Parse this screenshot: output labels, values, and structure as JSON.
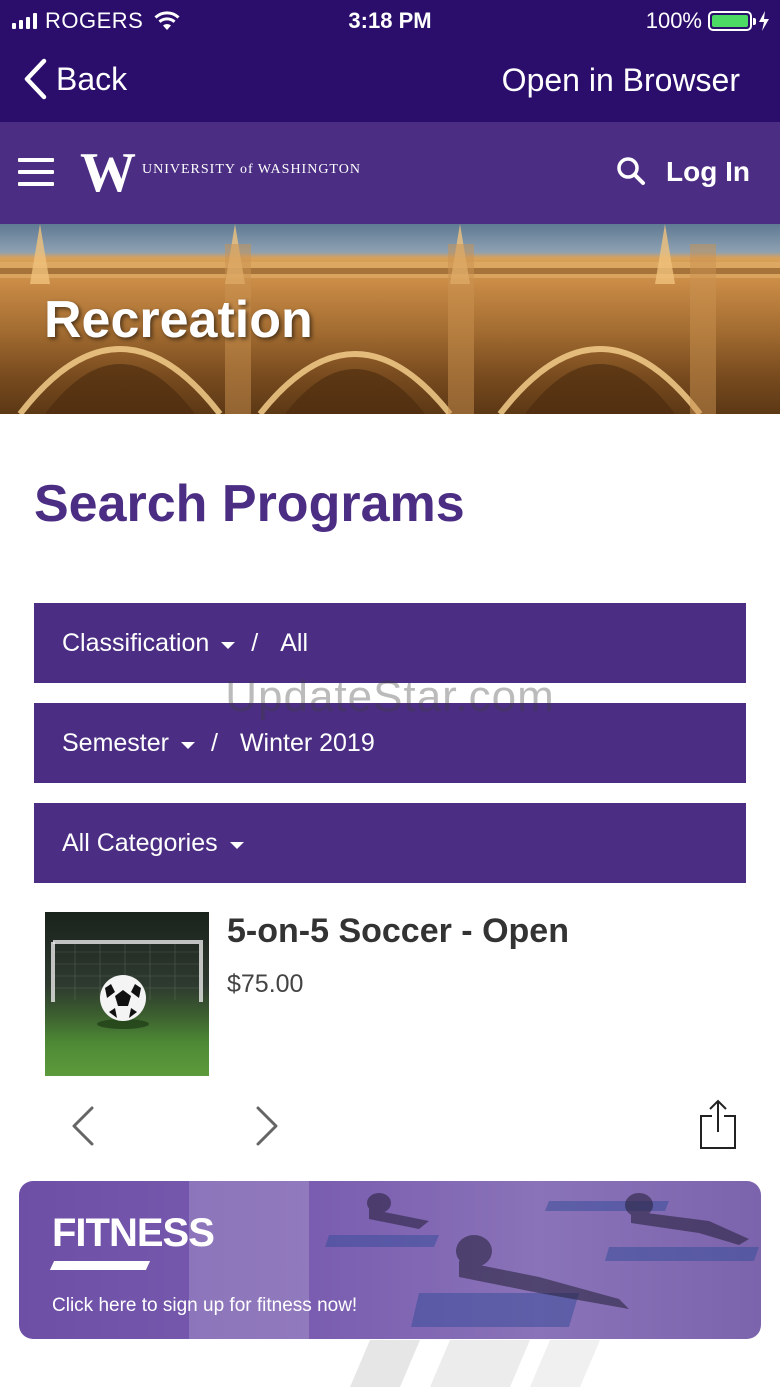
{
  "status_bar": {
    "carrier": "ROGERS",
    "time": "3:18 PM",
    "battery": "100%",
    "battery_level": 1.0
  },
  "nav": {
    "back_label": "Back",
    "open_browser_label": "Open in Browser"
  },
  "header": {
    "logo_letter": "W",
    "logo_text": "UNIVERSITY of WASHINGTON",
    "login_label": "Log In"
  },
  "hero": {
    "title": "Recreation"
  },
  "page_title": "Search Programs",
  "filters": {
    "classification_label": "Classification",
    "classification_value": "All",
    "semester_label": "Semester",
    "semester_value": "Winter 2019",
    "categories_label": "All Categories",
    "separator": "/"
  },
  "watermark": "UpdateStar.com",
  "program": {
    "title": "5-on-5 Soccer - Open",
    "price": "$75.00"
  },
  "banner": {
    "title": "FITNESS",
    "subtitle": "Click here to sign up for fitness now!"
  },
  "colors": {
    "nav_bg": "#2b0d6b",
    "brand_purple": "#4b2e83"
  }
}
